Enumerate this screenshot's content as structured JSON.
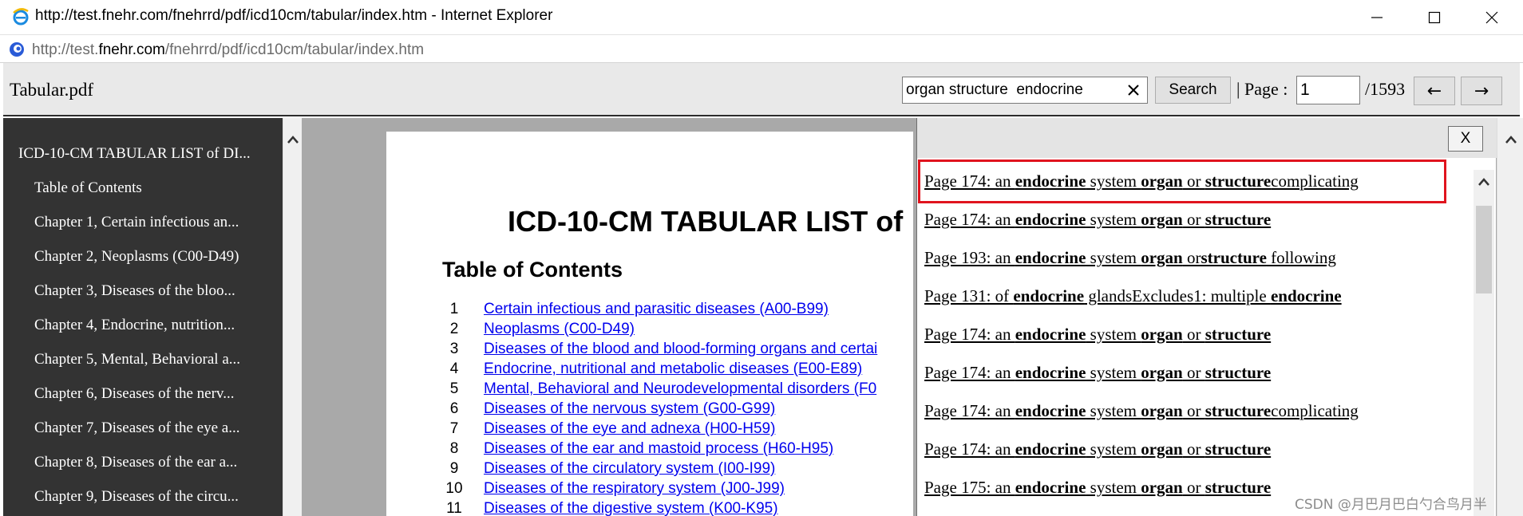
{
  "window": {
    "title": "http://test.fnehr.com/fnehrrd/pdf/icd10cm/tabular/index.htm - Internet Explorer",
    "minimize_icon": "minimize-icon",
    "maximize_icon": "maximize-icon",
    "close_icon": "close-icon"
  },
  "address": {
    "prefix": "http://test.",
    "host": "fnehr.com",
    "suffix": "/fnehrrd/pdf/icd10cm/tabular/index.htm"
  },
  "toolbar": {
    "doc_name": "Tabular.pdf",
    "search_value": "organ structure  endocrine",
    "search_button": "Search",
    "separator": "|",
    "page_label": "Page :",
    "page_value": "1",
    "page_total": "/1593",
    "prev_arrow": "←",
    "next_arrow": "→"
  },
  "sidebar": {
    "items": [
      {
        "label": "ICD-10-CM TABULAR LIST of DI..."
      },
      {
        "label": "Table of Contents"
      },
      {
        "label": "Chapter 1, Certain infectious an..."
      },
      {
        "label": "Chapter 2, Neoplasms (C00-D49)"
      },
      {
        "label": "Chapter 3, Diseases of the bloo..."
      },
      {
        "label": "Chapter 4, Endocrine, nutrition..."
      },
      {
        "label": "Chapter 5, Mental, Behavioral a..."
      },
      {
        "label": "Chapter 6, Diseases of the nerv..."
      },
      {
        "label": "Chapter 7, Diseases of the eye a..."
      },
      {
        "label": "Chapter 8, Diseases of the ear a..."
      },
      {
        "label": "Chapter 9, Diseases of the circu..."
      }
    ]
  },
  "document": {
    "title": "ICD-10-CM TABULAR LIST of",
    "toc_heading": "Table of Contents",
    "toc": [
      {
        "num": "1",
        "text": "Certain infectious and parasitic diseases (A00-B99)"
      },
      {
        "num": "2",
        "text": "Neoplasms (C00-D49)"
      },
      {
        "num": "3",
        "text": "Diseases of the blood and blood-forming organs and certai"
      },
      {
        "num": "4",
        "text": "Endocrine, nutritional and metabolic diseases (E00-E89)"
      },
      {
        "num": "5",
        "text": "Mental, Behavioral and Neurodevelopmental disorders (F0"
      },
      {
        "num": "6",
        "text": "Diseases of the nervous system (G00-G99)"
      },
      {
        "num": "7",
        "text": "Diseases of the eye and adnexa (H00-H59)"
      },
      {
        "num": "8",
        "text": "Diseases of the ear and mastoid process (H60-H95)"
      },
      {
        "num": "9",
        "text": "Diseases of the circulatory system (I00-I99)"
      },
      {
        "num": "10",
        "text": "Diseases of the respiratory system (J00-J99)"
      },
      {
        "num": "11",
        "text": "Diseases of the digestive system (K00-K95)"
      }
    ]
  },
  "results": {
    "close_label": "X",
    "items": [
      {
        "prefix": "Page 174: an ",
        "w1": "endocrine",
        "m1": " system ",
        "w2": "organ",
        "m2": " or ",
        "w3": "structure",
        "tail": "complicating"
      },
      {
        "prefix": "Page 174: an ",
        "w1": "endocrine",
        "m1": " system ",
        "w2": "organ",
        "m2": " or ",
        "w3": "structure",
        "tail": ""
      },
      {
        "prefix": "Page 193: an ",
        "w1": "endocrine",
        "m1": " system ",
        "w2": "organ",
        "m2": " or",
        "w3": "structure",
        "tail": " following"
      },
      {
        "prefix": "Page 131: of ",
        "w1": "endocrine",
        "m1": " glandsExcludes1: multiple ",
        "w2": "endocrine",
        "m2": "",
        "w3": "",
        "tail": ""
      },
      {
        "prefix": "Page 174: an ",
        "w1": "endocrine",
        "m1": " system ",
        "w2": "organ",
        "m2": " or ",
        "w3": "structure",
        "tail": ""
      },
      {
        "prefix": "Page 174: an ",
        "w1": "endocrine",
        "m1": " system ",
        "w2": "organ",
        "m2": " or ",
        "w3": "structure",
        "tail": ""
      },
      {
        "prefix": "Page 174: an ",
        "w1": "endocrine",
        "m1": " system ",
        "w2": "organ",
        "m2": " or ",
        "w3": "structure",
        "tail": "complicating"
      },
      {
        "prefix": "Page 174: an ",
        "w1": "endocrine",
        "m1": " system ",
        "w2": "organ",
        "m2": " or ",
        "w3": "structure",
        "tail": ""
      },
      {
        "prefix": "Page 175: an ",
        "w1": "endocrine",
        "m1": " system ",
        "w2": "organ",
        "m2": " or ",
        "w3": "structure",
        "tail": ""
      }
    ]
  },
  "watermark": "CSDN @月巴月巴白勺合鸟月半",
  "colors": {
    "sidebar_bg": "#333333",
    "doc_bg": "#a9a9a9",
    "link": "#0000ee",
    "highlight_border": "#e0141e"
  }
}
